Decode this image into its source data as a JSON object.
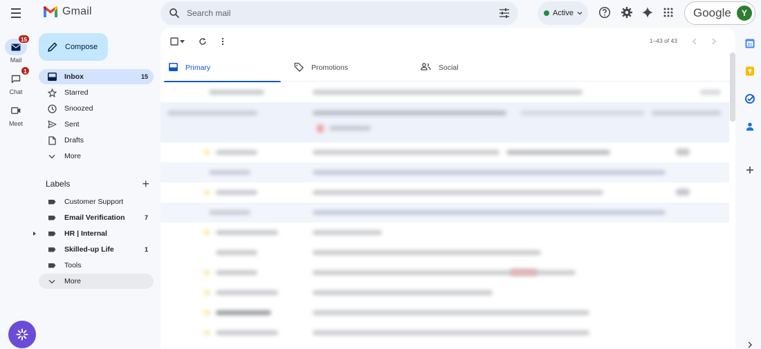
{
  "app": {
    "logo_text": "Gmail",
    "brand_colors": {
      "red": "#ea4335",
      "blue": "#4285f4",
      "green": "#34a853",
      "yellow": "#fbbc04"
    }
  },
  "rail": {
    "items": [
      {
        "label": "Mail",
        "icon": "mail-icon",
        "badge": "15",
        "active": true
      },
      {
        "label": "Chat",
        "icon": "chat-icon",
        "badge": "1",
        "active": false
      },
      {
        "label": "Meet",
        "icon": "video-icon",
        "badge": "",
        "active": false
      }
    ]
  },
  "search": {
    "placeholder": "Search mail"
  },
  "header": {
    "status": "Active",
    "status_color": "#1e8e3e",
    "account_brand": "Google",
    "avatar_initial": "Y",
    "avatar_color": "#2e7d32"
  },
  "compose": {
    "label": "Compose"
  },
  "nav": {
    "items": [
      {
        "label": "Inbox",
        "count": "15",
        "icon": "inbox-icon"
      },
      {
        "label": "Starred",
        "count": "",
        "icon": "star-icon"
      },
      {
        "label": "Snoozed",
        "count": "",
        "icon": "clock-icon"
      },
      {
        "label": "Sent",
        "count": "",
        "icon": "send-icon"
      },
      {
        "label": "Drafts",
        "count": "",
        "icon": "draft-icon"
      },
      {
        "label": "More",
        "count": "",
        "icon": "chevron-down-icon"
      }
    ]
  },
  "labels": {
    "heading": "Labels",
    "items": [
      {
        "label": "Customer Support",
        "count": ""
      },
      {
        "label": "Email Verification",
        "count": "7"
      },
      {
        "label": "HR | Internal",
        "count": ""
      },
      {
        "label": "Skilled-up Life",
        "count": "1"
      },
      {
        "label": "Tools",
        "count": ""
      }
    ],
    "more": "More"
  },
  "toolbar": {
    "pager": "1–43 of 43"
  },
  "tabs": [
    {
      "label": "Primary",
      "icon": "inbox-icon"
    },
    {
      "label": "Promotions",
      "icon": "tag-icon"
    },
    {
      "label": "Social",
      "icon": "people-icon"
    }
  ],
  "side_panel": {
    "icons": [
      "calendar-icon",
      "keep-icon",
      "tasks-icon",
      "contacts-icon",
      "add-icon",
      "chevron-right-icon"
    ]
  }
}
